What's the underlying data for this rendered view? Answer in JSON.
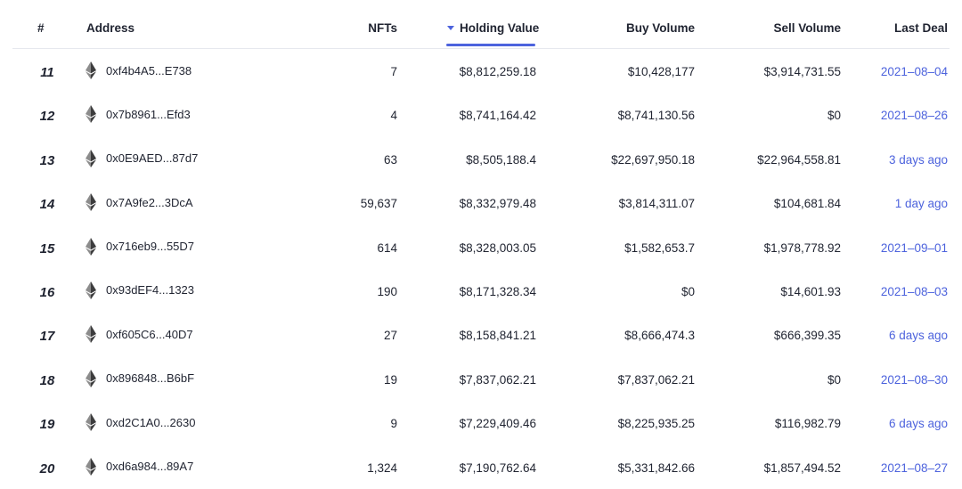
{
  "header": {
    "rank": "#",
    "address": "Address",
    "nfts": "NFTs",
    "holding_value": "Holding Value",
    "buy_volume": "Buy Volume",
    "sell_volume": "Sell Volume",
    "last_deal": "Last Deal"
  },
  "icons": {
    "chain": "ethereum-icon",
    "sort": "sort-desc-icon"
  },
  "colors": {
    "accent": "#4d63dd",
    "eth_dark": "#3c3c3d",
    "eth_mid": "#8c8c8c"
  },
  "rows": [
    {
      "rank": "11",
      "address": "0xf4b4A5...E738",
      "nfts": "7",
      "holding_value": "$8,812,259.18",
      "buy_volume": "$10,428,177",
      "sell_volume": "$3,914,731.55",
      "last_deal": "2021–08–04"
    },
    {
      "rank": "12",
      "address": "0x7b8961...Efd3",
      "nfts": "4",
      "holding_value": "$8,741,164.42",
      "buy_volume": "$8,741,130.56",
      "sell_volume": "$0",
      "last_deal": "2021–08–26"
    },
    {
      "rank": "13",
      "address": "0x0E9AED...87d7",
      "nfts": "63",
      "holding_value": "$8,505,188.4",
      "buy_volume": "$22,697,950.18",
      "sell_volume": "$22,964,558.81",
      "last_deal": "3 days ago"
    },
    {
      "rank": "14",
      "address": "0x7A9fe2...3DcA",
      "nfts": "59,637",
      "holding_value": "$8,332,979.48",
      "buy_volume": "$3,814,311.07",
      "sell_volume": "$104,681.84",
      "last_deal": "1 day ago"
    },
    {
      "rank": "15",
      "address": "0x716eb9...55D7",
      "nfts": "614",
      "holding_value": "$8,328,003.05",
      "buy_volume": "$1,582,653.7",
      "sell_volume": "$1,978,778.92",
      "last_deal": "2021–09–01"
    },
    {
      "rank": "16",
      "address": "0x93dEF4...1323",
      "nfts": "190",
      "holding_value": "$8,171,328.34",
      "buy_volume": "$0",
      "sell_volume": "$14,601.93",
      "last_deal": "2021–08–03"
    },
    {
      "rank": "17",
      "address": "0xf605C6...40D7",
      "nfts": "27",
      "holding_value": "$8,158,841.21",
      "buy_volume": "$8,666,474.3",
      "sell_volume": "$666,399.35",
      "last_deal": "6 days ago"
    },
    {
      "rank": "18",
      "address": "0x896848...B6bF",
      "nfts": "19",
      "holding_value": "$7,837,062.21",
      "buy_volume": "$7,837,062.21",
      "sell_volume": "$0",
      "last_deal": "2021–08–30"
    },
    {
      "rank": "19",
      "address": "0xd2C1A0...2630",
      "nfts": "9",
      "holding_value": "$7,229,409.46",
      "buy_volume": "$8,225,935.25",
      "sell_volume": "$116,982.79",
      "last_deal": "6 days ago"
    },
    {
      "rank": "20",
      "address": "0xd6a984...89A7",
      "nfts": "1,324",
      "holding_value": "$7,190,762.64",
      "buy_volume": "$5,331,842.66",
      "sell_volume": "$1,857,494.52",
      "last_deal": "2021–08–27"
    }
  ]
}
